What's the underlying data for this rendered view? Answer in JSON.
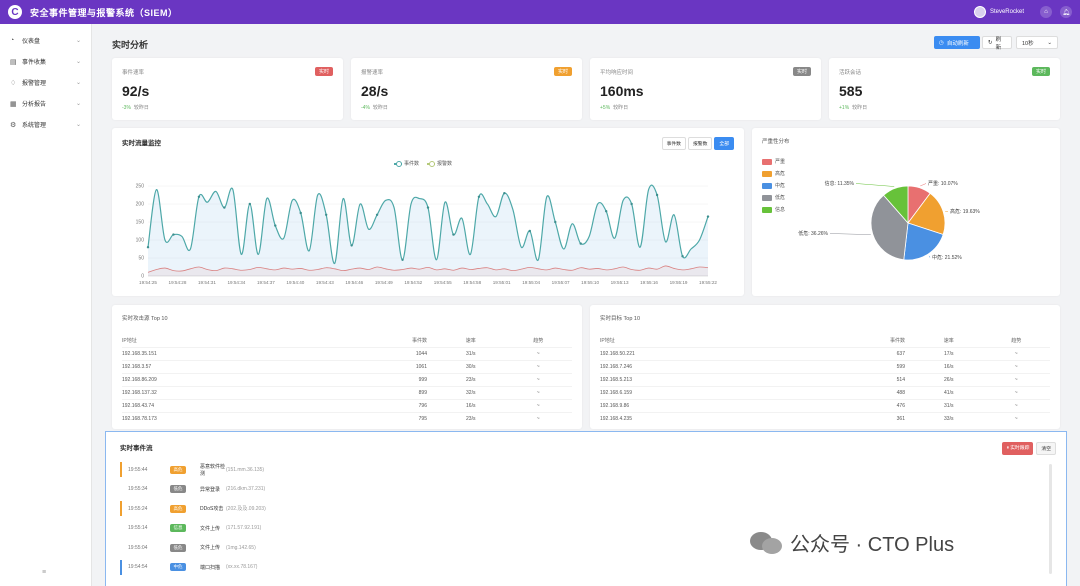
{
  "app": {
    "logo": "C",
    "title": "安全事件管理与报警系统（SIEM）",
    "user": "SteveRocket"
  },
  "sidebar": {
    "items": [
      {
        "label": "仪表盘",
        "icon": "dashboard-icon"
      },
      {
        "label": "事件收集",
        "icon": "collect-icon"
      },
      {
        "label": "报警管理",
        "icon": "bell-icon"
      },
      {
        "label": "分析报告",
        "icon": "report-icon"
      },
      {
        "label": "系统管理",
        "icon": "gear-icon"
      }
    ],
    "collapse_glyph": "≡"
  },
  "page": {
    "title": "实时分析",
    "auto_refresh": "自动刷新",
    "refresh": "刷新",
    "interval": "10秒"
  },
  "stats": [
    {
      "label": "事件速率",
      "badge": "实时",
      "badge_color": "#e06060",
      "value": "92/s",
      "change": "-3%",
      "change_label": "较昨日"
    },
    {
      "label": "报警速率",
      "badge": "实时",
      "badge_color": "#f0a030",
      "value": "28/s",
      "change": "-4%",
      "change_label": "较昨日"
    },
    {
      "label": "平均响应时间",
      "badge": "实时",
      "badge_color": "#888888",
      "value": "160ms",
      "change": "+5%",
      "change_label": "较昨日"
    },
    {
      "label": "活跃会话",
      "badge": "实时",
      "badge_color": "#5cb85c",
      "value": "585",
      "change": "+1%",
      "change_label": "较昨日"
    }
  ],
  "trend": {
    "title": "实时流量监控",
    "buttons": [
      "事件数",
      "报警数",
      "全部"
    ],
    "active_button": 2
  },
  "pie": {
    "title": "严重性分布",
    "legend": [
      "严重",
      "高危",
      "中危",
      "低危",
      "信息"
    ],
    "labels": [
      "严重: 10.07%",
      "高危: 19.63%",
      "中危: 21.52%",
      "低危: 36.26%",
      "信息: 11.35%"
    ]
  },
  "sources": {
    "title": "实时攻击源 Top 10",
    "headers": [
      "IP地址",
      "事件数",
      "速率",
      "趋势"
    ],
    "rows": [
      [
        "192.168.35.151",
        "1044",
        "31/s",
        "~"
      ],
      [
        "192.168.3.57",
        "1061",
        "30/s",
        "~"
      ],
      [
        "192.168.86.209",
        "999",
        "23/s",
        "~"
      ],
      [
        "192.168.137.32",
        "899",
        "32/s",
        "~"
      ],
      [
        "192.168.43.74",
        "796",
        "16/s",
        "~"
      ],
      [
        "192.168.78.173",
        "795",
        "23/s",
        "~"
      ]
    ]
  },
  "targets": {
    "title": "实时目标 Top 10",
    "headers": [
      "IP地址",
      "事件数",
      "速率",
      "趋势"
    ],
    "rows": [
      [
        "192.168.50.221",
        "637",
        "17/s",
        "~"
      ],
      [
        "192.168.7.246",
        "599",
        "16/s",
        "~"
      ],
      [
        "192.168.5.213",
        "514",
        "26/s",
        "~"
      ],
      [
        "192.168.6.159",
        "488",
        "41/s",
        "~"
      ],
      [
        "192.168.9.86",
        "476",
        "31/s",
        "~"
      ],
      [
        "192.168.4.235",
        "361",
        "33/s",
        "~"
      ]
    ]
  },
  "stream": {
    "title": "实时事件流",
    "btn_live": "实时跟踪",
    "btn_clear": "清空",
    "events": [
      {
        "time": "19:55:44",
        "level": "高危",
        "color": "#f0a030",
        "type": "恶意软件检测",
        "ip": "(151.mm.36.135)"
      },
      {
        "time": "19:55:34",
        "level": "低危",
        "color": "#888888",
        "type": "异常登录",
        "ip": "(216.dkm.37.231)"
      },
      {
        "time": "19:55:24",
        "level": "高危",
        "color": "#f0a030",
        "type": "DDoS攻击",
        "ip": "(202.及及.09.203)"
      },
      {
        "time": "19:55:14",
        "level": "信息",
        "color": "#5cb85c",
        "type": "文件上传",
        "ip": "(171.57.92.191)"
      },
      {
        "time": "19:55:04",
        "level": "低危",
        "color": "#888888",
        "type": "文件上传",
        "ip": "(1mg.142.65)"
      },
      {
        "time": "19:54:54",
        "level": "中危",
        "color": "#4a90e2",
        "type": "端口扫描",
        "ip": "(xx.xx.78.167)"
      }
    ]
  },
  "watermark": {
    "text": "公众号 · CTO Plus"
  },
  "chart_data": [
    {
      "type": "line",
      "title": "实时流量监控",
      "x": [
        "19:54:25",
        "19:54:28",
        "19:54:31",
        "19:54:34",
        "19:54:37",
        "19:54:40",
        "19:54:43",
        "19:54:46",
        "19:54:49",
        "19:54:52",
        "19:54:55",
        "19:54:58",
        "19:55:01",
        "19:55:04",
        "19:55:07",
        "19:55:10",
        "19:55:13",
        "19:55:16",
        "19:55:19",
        "19:55:22"
      ],
      "ylim": [
        0,
        250
      ],
      "yticks": [
        0,
        50,
        100,
        150,
        200,
        250
      ],
      "grid": true,
      "legend": "top-center",
      "series": [
        {
          "name": "事件数",
          "color": "#4ea8a8",
          "values": [
            80,
            240,
            100,
            115,
            110,
            75,
            220,
            205,
            235,
            190,
            240,
            60,
            200,
            60,
            215,
            140,
            105,
            210,
            175,
            70,
            225,
            170,
            35,
            215,
            85,
            200,
            130,
            170,
            210,
            190,
            45,
            200,
            215,
            190,
            45,
            205,
            115,
            160,
            60,
            220,
            200,
            165,
            230,
            185,
            80,
            125,
            45,
            220,
            150,
            75,
            145,
            90,
            110,
            200,
            180,
            105,
            210,
            200,
            80,
            240,
            225,
            95,
            170,
            55,
            75,
            100,
            165
          ]
        },
        {
          "name": "报警数",
          "color": "#d98080",
          "values": [
            10,
            18,
            22,
            15,
            14,
            20,
            25,
            18,
            15,
            22,
            20,
            16,
            18,
            24,
            20,
            17,
            22,
            19,
            21,
            16,
            18,
            23,
            20,
            15,
            19,
            22,
            18,
            25,
            20,
            16,
            18,
            22,
            19,
            24,
            17,
            20,
            16,
            22,
            18,
            21,
            23,
            17,
            20,
            15,
            19,
            24,
            20,
            17,
            22,
            18,
            16,
            23,
            19,
            21,
            17,
            20,
            25,
            18,
            16,
            22,
            19,
            28,
            21,
            17,
            20,
            25,
            23
          ]
        }
      ]
    },
    {
      "type": "pie",
      "title": "严重性分布",
      "categories": [
        "严重",
        "高危",
        "中危",
        "低危",
        "信息"
      ],
      "values": [
        10.07,
        19.63,
        21.52,
        36.26,
        11.35
      ],
      "colors": [
        "#e87070",
        "#f0a030",
        "#4a90e2",
        "#909399",
        "#67c23a"
      ],
      "legend": "left"
    }
  ]
}
